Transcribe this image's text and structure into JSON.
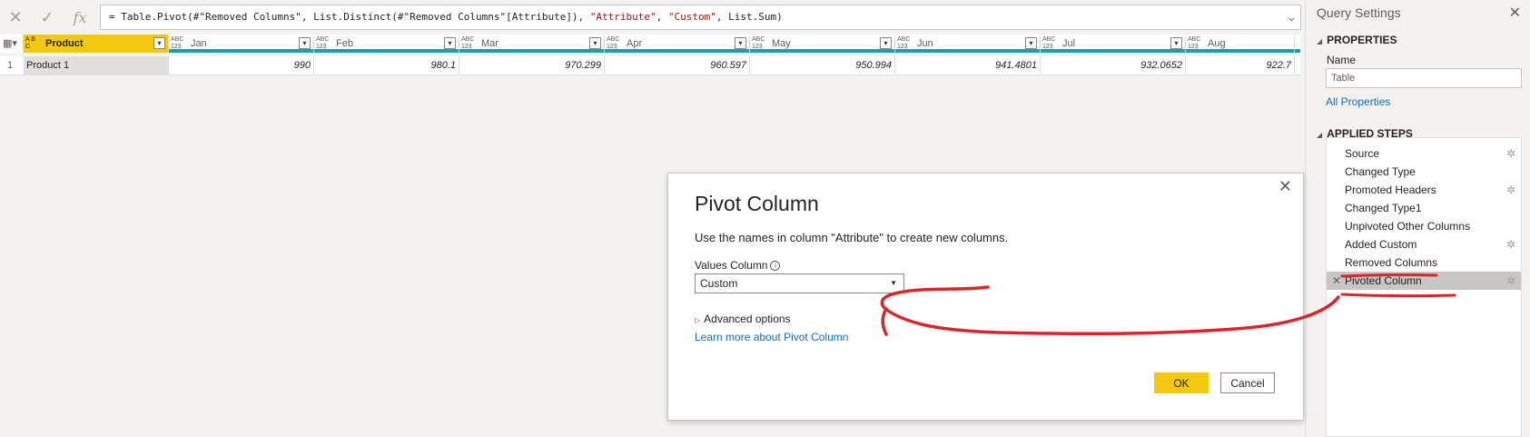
{
  "formula": {
    "prefix": "= Table.Pivot(#\"Removed Columns\", List.Distinct(#\"Removed Columns\"[Attribute]), ",
    "arg1": "\"Attribute\"",
    "sep1": ", ",
    "arg2": "\"Custom\"",
    "suffix": ", List.Sum)"
  },
  "grid": {
    "columns": [
      {
        "name": "Product",
        "type_top": "A B",
        "type_bottom": "C"
      },
      {
        "name": "Jan",
        "type_top": "ABC",
        "type_bottom": "123"
      },
      {
        "name": "Feb",
        "type_top": "ABC",
        "type_bottom": "123"
      },
      {
        "name": "Mar",
        "type_top": "ABC",
        "type_bottom": "123"
      },
      {
        "name": "Apr",
        "type_top": "ABC",
        "type_bottom": "123"
      },
      {
        "name": "May",
        "type_top": "ABC",
        "type_bottom": "123"
      },
      {
        "name": "Jun",
        "type_top": "ABC",
        "type_bottom": "123"
      },
      {
        "name": "Jul",
        "type_top": "ABC",
        "type_bottom": "123"
      },
      {
        "name": "Aug",
        "type_top": "ABC",
        "type_bottom": "123"
      }
    ],
    "row": {
      "index": "1",
      "product": "Product 1",
      "values": [
        "990",
        "980.1",
        "970.299",
        "960.597",
        "950.994",
        "941.4801",
        "932.0652",
        "922.7"
      ]
    }
  },
  "query_settings": {
    "title": "Query Settings",
    "properties_heading": "PROPERTIES",
    "name_label": "Name",
    "name_value": "Table",
    "all_properties": "All Properties",
    "applied_steps_heading": "APPLIED STEPS",
    "steps": [
      {
        "label": "Source",
        "gear": true
      },
      {
        "label": "Changed Type",
        "gear": false
      },
      {
        "label": "Promoted Headers",
        "gear": true
      },
      {
        "label": "Changed Type1",
        "gear": false
      },
      {
        "label": "Unpivoted Other Columns",
        "gear": false
      },
      {
        "label": "Added Custom",
        "gear": true
      },
      {
        "label": "Removed Columns",
        "gear": false
      },
      {
        "label": "Pivoted Column",
        "gear": true
      }
    ]
  },
  "dialog": {
    "title": "Pivot Column",
    "description": "Use the names in column \"Attribute\" to create new columns.",
    "values_column_label": "Values Column",
    "values_column_value": "Custom",
    "advanced_options": "Advanced options",
    "learn_more": "Learn more about Pivot Column",
    "ok": "OK",
    "cancel": "Cancel"
  },
  "colors": {
    "accent": "#f2c811",
    "annotation": "#d9262c",
    "link": "#106ebe",
    "header_rule": "#17a1a1"
  }
}
